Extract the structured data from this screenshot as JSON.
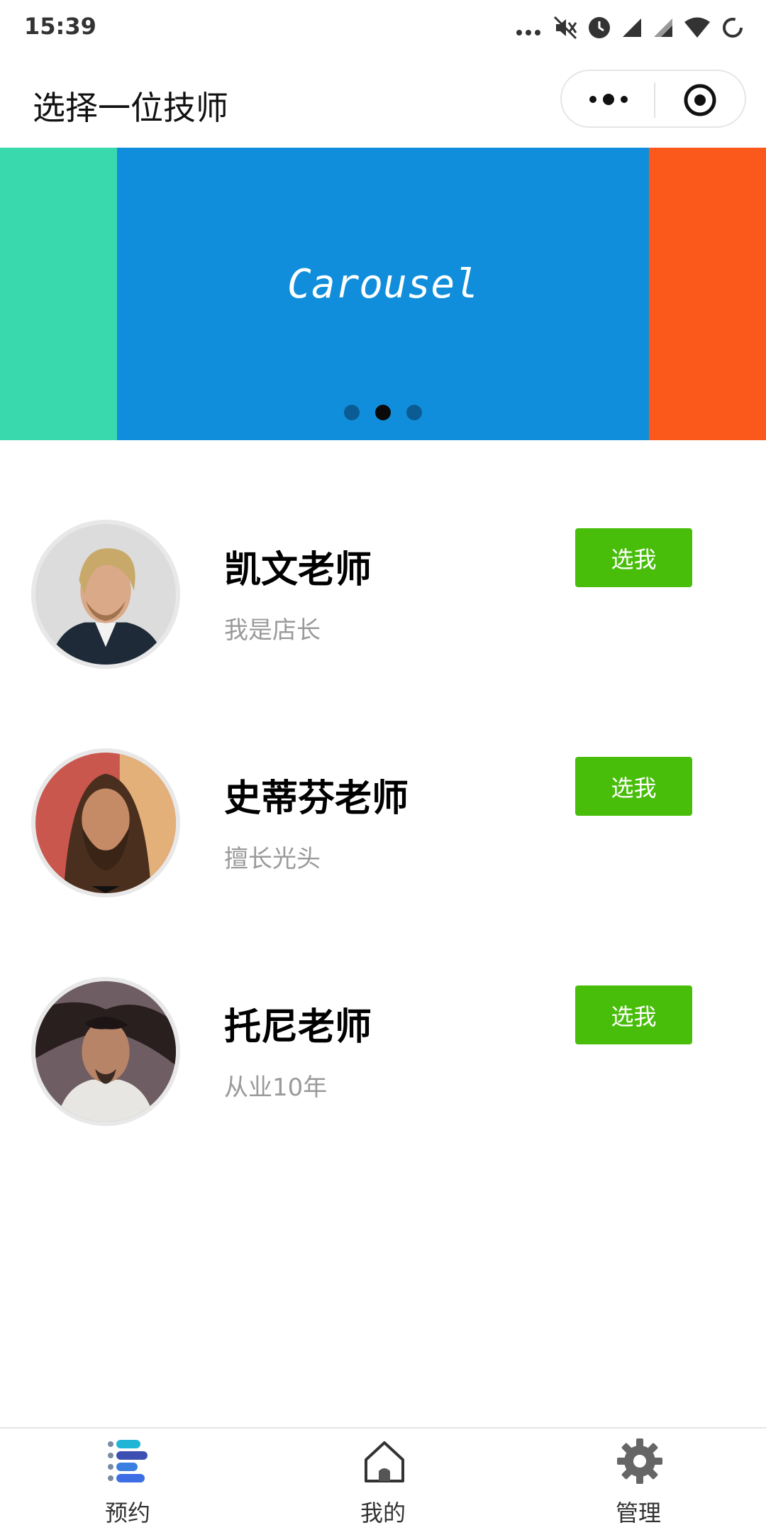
{
  "status_bar": {
    "time": "15:39",
    "icons": [
      "more-dots-icon",
      "mute-icon",
      "alarm-icon",
      "signal-icon",
      "signal-icon",
      "wifi-icon",
      "battery-loading-icon"
    ]
  },
  "nav": {
    "title": "选择一位技师",
    "capsule_icons": [
      "more-icon",
      "close-target-icon"
    ]
  },
  "carousel": {
    "label": "Carousel",
    "active_index": 1,
    "slide_colors": [
      "#3ad8ad",
      "#118edb",
      "#fb591b"
    ]
  },
  "technicians": [
    {
      "name": "凯文老师",
      "desc": "我是店长",
      "button": "选我"
    },
    {
      "name": "史蒂芬老师",
      "desc": "擅长光头",
      "button": "选我"
    },
    {
      "name": "托尼老师",
      "desc": "从业10年",
      "button": "选我"
    }
  ],
  "tabs": [
    {
      "label": "预约",
      "icon": "list-icon"
    },
    {
      "label": "我的",
      "icon": "home-icon"
    },
    {
      "label": "管理",
      "icon": "gear-icon"
    }
  ],
  "colors": {
    "accent_green": "#48be0a",
    "carousel_blue": "#118edb"
  }
}
